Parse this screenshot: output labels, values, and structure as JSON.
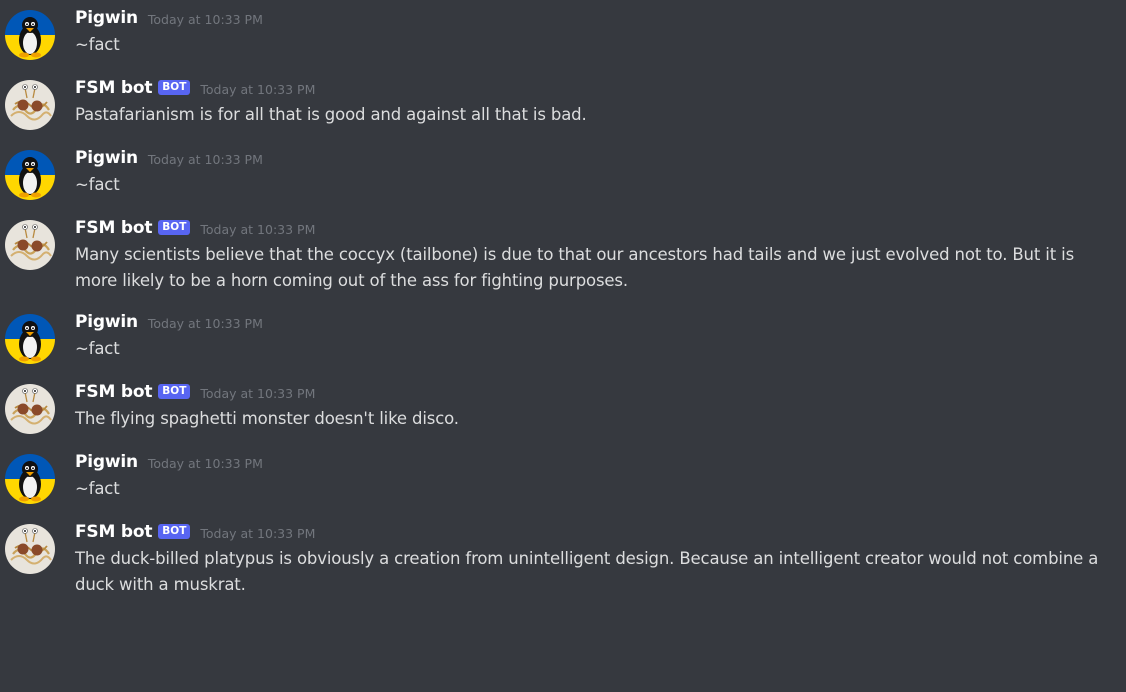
{
  "users": {
    "pigwin": {
      "name": "Pigwin",
      "avatar_icon": "tux-penguin-icon",
      "avatar_colors": [
        "#0057b7",
        "#ffd700"
      ]
    },
    "fsm": {
      "name": "FSM bot",
      "badge": "BOT",
      "avatar_icon": "flying-spaghetti-monster-icon"
    }
  },
  "messages": [
    {
      "author": "Pigwin",
      "timestamp": "Today at 10:33 PM",
      "text": "~fact"
    },
    {
      "author": "FSM bot",
      "badge": "BOT",
      "timestamp": "Today at 10:33 PM",
      "text": "Pastafarianism is for all that is good and against all that is bad."
    },
    {
      "author": "Pigwin",
      "timestamp": "Today at 10:33 PM",
      "text": "~fact"
    },
    {
      "author": "FSM bot",
      "badge": "BOT",
      "timestamp": "Today at 10:33 PM",
      "text": "Many scientists believe that the coccyx (tailbone) is due to that our ancestors had tails and we just evolved not to. But it is more likely to be a horn coming out of the ass for fighting purposes."
    },
    {
      "author": "Pigwin",
      "timestamp": "Today at 10:33 PM",
      "text": "~fact"
    },
    {
      "author": "FSM bot",
      "badge": "BOT",
      "timestamp": "Today at 10:33 PM",
      "text": "The flying spaghetti monster doesn't like disco."
    },
    {
      "author": "Pigwin",
      "timestamp": "Today at 10:33 PM",
      "text": "~fact"
    },
    {
      "author": "FSM bot",
      "badge": "BOT",
      "timestamp": "Today at 10:33 PM",
      "text": "The duck-billed platypus is obviously a creation from unintelligent design. Because an intelligent creator would not combine a duck with a muskrat."
    }
  ],
  "colors": {
    "background": "#36393f",
    "username": "#ffffff",
    "message_text": "#dcddde",
    "timestamp": "#72767d",
    "bot_badge": "#5865f2"
  }
}
